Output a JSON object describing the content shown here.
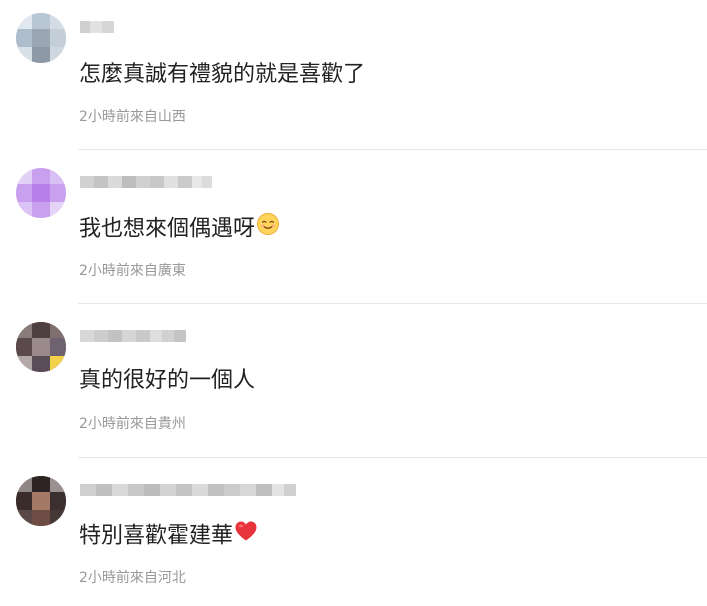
{
  "comments": [
    {
      "text": "怎麼真誠有禮貌的就是喜歡了",
      "meta": "2小時前來自山西",
      "emoji": ""
    },
    {
      "text": "我也想來個偶遇呀",
      "meta": "2小時前來自廣東",
      "emoji": "smiling-face-icon"
    },
    {
      "text": "真的很好的一個人",
      "meta": "2小時前來自貴州",
      "emoji": ""
    },
    {
      "text": "特別喜歡霍建華",
      "meta": "2小時前來自河北",
      "emoji": "red-heart-icon"
    }
  ],
  "colors": {
    "text": "#222222",
    "meta": "#999999",
    "divider": "#e8e8e8"
  }
}
